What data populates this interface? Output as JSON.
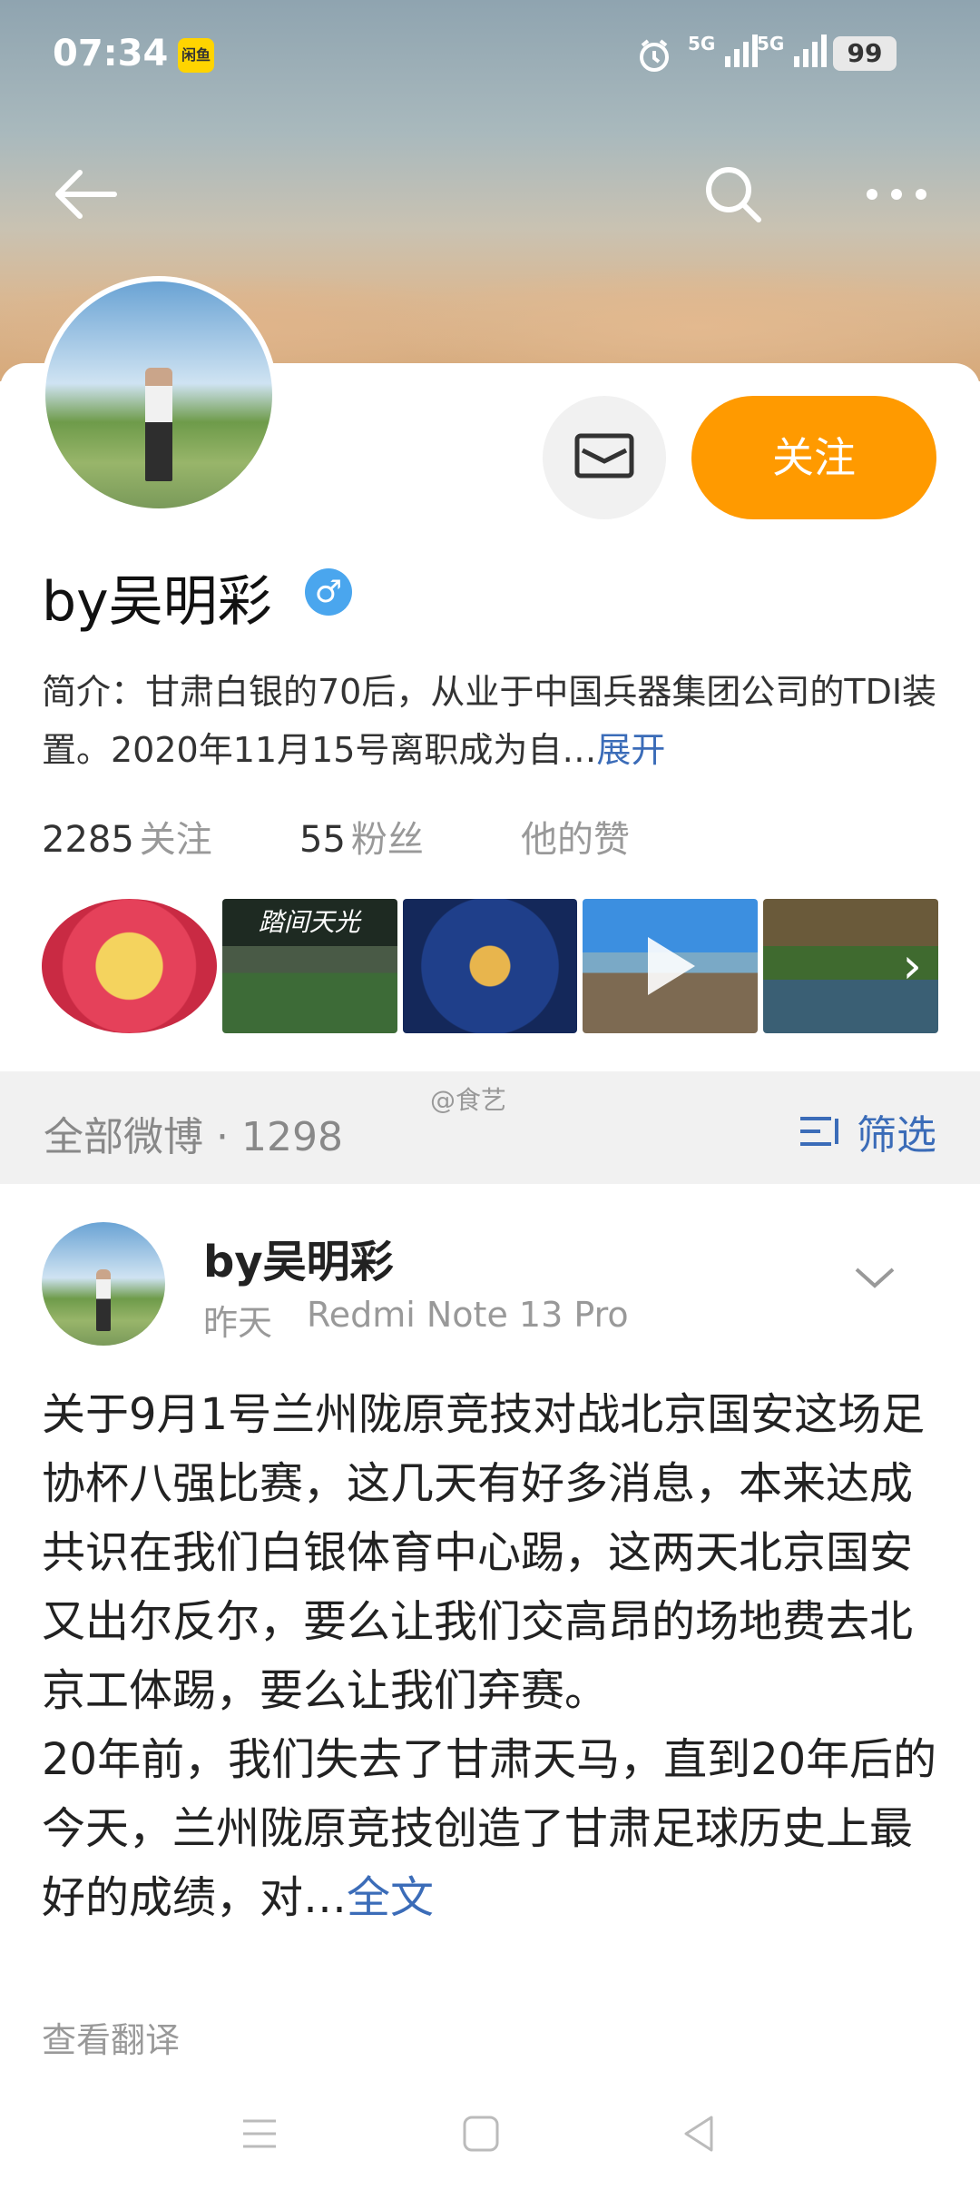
{
  "status_bar": {
    "time": "07:34",
    "app_badge": "闲鱼",
    "signal_1": "5G",
    "signal_2": "5G",
    "battery": "99"
  },
  "header": {
    "back_icon": "arrow-left-icon",
    "search_icon": "search-icon",
    "more_icon": "more-dots-icon"
  },
  "profile": {
    "name": "by吴明彩",
    "verified_icon": "male-verified-icon",
    "bio_text": "简介：甘肃白银的70后，从业于中国兵器集团公司的TDI装置。2020年11月15号离职成为自…",
    "bio_more": "展开",
    "message_icon": "message-icon",
    "follow_label": "关注",
    "stats": [
      {
        "num": "2285",
        "label": "关注"
      },
      {
        "num": "55",
        "label": "粉丝"
      },
      {
        "num": "",
        "label": "他的赞"
      }
    ],
    "thumb_text": "踏间天光"
  },
  "feed": {
    "section_title": "全部微博 · 1298",
    "watermark": "@食艺",
    "filter_label": "筛选",
    "post": {
      "author": "by吴明彩",
      "time": "昨天",
      "device": "Redmi Note 13 Pro",
      "text": "关于9月1号兰州陇原竞技对战北京国安这场足协杯八强比赛，这几天有好多消息，本来达成共识在我们白银体育中心踢，这两天北京国安又出尔反尔，要么让我们交高昂的场地费去北京工体踢，要么让我们弃赛。\n20年前，我们失去了甘肃天马，直到20年后的今天，兰州陇原竞技创造了甘肃足球历史上最好的成绩，对…",
      "full_text": "全文",
      "translate": "查看翻译"
    }
  },
  "colors": {
    "accent": "#ff9a00",
    "link": "#3b6cb8",
    "verify": "#4aa6ee"
  }
}
